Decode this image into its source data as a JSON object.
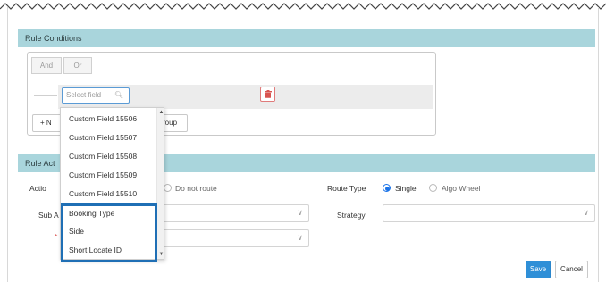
{
  "rule_conditions": {
    "title": "Rule Conditions",
    "logic_and": "And",
    "logic_or": "Or",
    "field_placeholder": "Select field",
    "new_button_label": "+ N",
    "group_button_label": "roup"
  },
  "field_dropdown": {
    "items": [
      "Custom Field 15506",
      "Custom Field 15507",
      "Custom Field 15508",
      "Custom Field 15509",
      "Custom Field 15510",
      "Booking Type",
      "Side",
      "Short Locate ID"
    ]
  },
  "rule_actions": {
    "title_partial": "Rule Act",
    "action_label_partial": "Actio",
    "do_not_route_label": "Do not route",
    "route_type_label": "Route Type",
    "route_type_single": "Single",
    "route_type_algo": "Algo Wheel",
    "sub_label_partial": "Sub A",
    "strategy_label": "Strategy",
    "required_marker": "*"
  },
  "footer": {
    "save_label": "Save",
    "cancel_label": "Cancel"
  },
  "colors": {
    "section_bar": "#a9d5dc",
    "accent_blue": "#1a73e8",
    "save_button": "#2f8fd7",
    "highlight_border": "#1f6fb5",
    "delete_red": "#d9534f"
  }
}
